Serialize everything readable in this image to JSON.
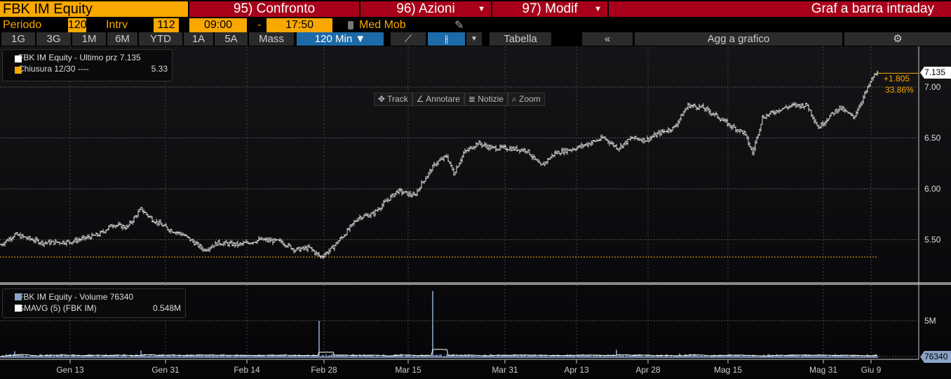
{
  "header": {
    "ticker": "FBK IM Equity",
    "btn95": "95) Confronto",
    "btn96": "96) Azioni",
    "btn97": "97) Modif",
    "title": "Graf a barra intraday"
  },
  "params": {
    "periodo_label": "Periodo",
    "periodo": "120",
    "intrv_label": "Intrv",
    "intrv": "112",
    "start": "09:00",
    "dash": "-",
    "end": "17:50",
    "med_mob": "Med Mob"
  },
  "ranges": [
    "1G",
    "3G",
    "1M",
    "6M",
    "YTD",
    "1A",
    "5A",
    "Mass"
  ],
  "interval": "120 Min ▼",
  "toolbar": {
    "tabella": "Tabella",
    "collapse": "«",
    "agg": "Agg a grafico",
    "settings": "⚙"
  },
  "tools": [
    "✥ Track",
    "∠ Annotare",
    "≣ Notizie",
    "⌕ Zoom"
  ],
  "legend": {
    "line1": "FBK IM Equity - Ultimo prz 7.135",
    "line2": "Chiusura 12/30 ----",
    "line2_val": "5.33"
  },
  "vol_legend": {
    "line1": "FBK IM Equity - Volume 76340",
    "line2": "SMAVG (5) (FBK IM)",
    "line2_val": "0.548M"
  },
  "last": {
    "price": "7.135",
    "change": "+1.805",
    "pct": "33.86%",
    "volume": "76340"
  },
  "colors": {
    "accent": "#f9a800",
    "red": "#a8001a",
    "volume": "#8aa4c8"
  },
  "chart_data": {
    "type": "bar",
    "x_unit": "bar index (120-min bars)",
    "xlim": [
      0,
      655
    ],
    "price_ylim": [
      5.2,
      7.3
    ],
    "price_ticks": [
      "5.50",
      "6.00",
      "6.50",
      "7.00"
    ],
    "ref_close": 5.33,
    "price_keypoints": [
      [
        0,
        5.45
      ],
      [
        10,
        5.55
      ],
      [
        30,
        5.47
      ],
      [
        50,
        5.48
      ],
      [
        70,
        5.55
      ],
      [
        80,
        5.65
      ],
      [
        90,
        5.62
      ],
      [
        100,
        5.8
      ],
      [
        108,
        5.7
      ],
      [
        120,
        5.6
      ],
      [
        130,
        5.55
      ],
      [
        145,
        5.4
      ],
      [
        155,
        5.47
      ],
      [
        170,
        5.45
      ],
      [
        185,
        5.5
      ],
      [
        200,
        5.48
      ],
      [
        210,
        5.4
      ],
      [
        220,
        5.42
      ],
      [
        228,
        5.33
      ],
      [
        235,
        5.4
      ],
      [
        245,
        5.55
      ],
      [
        255,
        5.72
      ],
      [
        265,
        5.75
      ],
      [
        275,
        5.88
      ],
      [
        283,
        5.98
      ],
      [
        295,
        5.93
      ],
      [
        300,
        6.05
      ],
      [
        310,
        6.25
      ],
      [
        318,
        6.32
      ],
      [
        323,
        6.15
      ],
      [
        330,
        6.35
      ],
      [
        340,
        6.45
      ],
      [
        350,
        6.4
      ],
      [
        360,
        6.4
      ],
      [
        375,
        6.38
      ],
      [
        385,
        6.22
      ],
      [
        395,
        6.35
      ],
      [
        410,
        6.4
      ],
      [
        420,
        6.45
      ],
      [
        430,
        6.5
      ],
      [
        440,
        6.4
      ],
      [
        450,
        6.5
      ],
      [
        460,
        6.48
      ],
      [
        470,
        6.55
      ],
      [
        480,
        6.6
      ],
      [
        490,
        6.82
      ],
      [
        500,
        6.8
      ],
      [
        510,
        6.72
      ],
      [
        520,
        6.62
      ],
      [
        530,
        6.55
      ],
      [
        536,
        6.35
      ],
      [
        543,
        6.7
      ],
      [
        555,
        6.78
      ],
      [
        565,
        6.82
      ],
      [
        575,
        6.82
      ],
      [
        583,
        6.6
      ],
      [
        590,
        6.7
      ],
      [
        598,
        6.8
      ],
      [
        608,
        6.7
      ],
      [
        615,
        6.9
      ],
      [
        622,
        7.1
      ],
      [
        625,
        7.135
      ]
    ],
    "volume_ylim": [
      0,
      9.5
    ],
    "volume_unit": "M",
    "volume_ticks": [
      "5M"
    ],
    "volume_base": 0.35,
    "volume_spikes": [
      [
        10,
        0.9
      ],
      [
        100,
        1.0
      ],
      [
        227,
        5.0
      ],
      [
        308,
        9.0
      ],
      [
        439,
        1.1
      ],
      [
        484,
        0.6
      ]
    ],
    "x_ticks": [
      {
        "label": "Gen 13",
        "bar": 50
      },
      {
        "label": "Gen 31",
        "bar": 118
      },
      {
        "label": "Feb 14",
        "bar": 176
      },
      {
        "label": "Feb 28",
        "bar": 231
      },
      {
        "label": "Mar 15",
        "bar": 291
      },
      {
        "label": "Mar 31",
        "bar": 360
      },
      {
        "label": "Apr 13",
        "bar": 411
      },
      {
        "label": "Apr 28",
        "bar": 462
      },
      {
        "label": "Mag 15",
        "bar": 519
      },
      {
        "label": "Mag 31",
        "bar": 587
      },
      {
        "label": "Giu 9",
        "bar": 621
      }
    ]
  }
}
